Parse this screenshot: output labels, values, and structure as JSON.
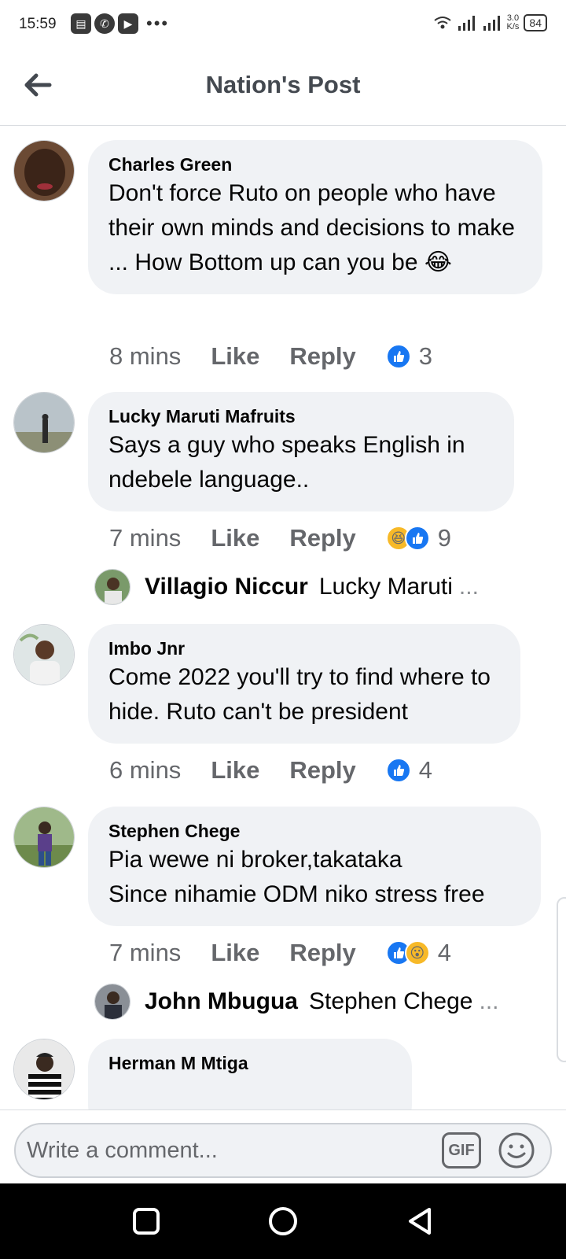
{
  "status": {
    "time": "15:59",
    "speed_top": "3.0",
    "speed_bottom": "K/s",
    "battery": "84"
  },
  "header": {
    "title": "Nation's Post"
  },
  "comments": [
    {
      "name": "Charles Green",
      "text": "Don't force Ruto on people who have their own minds and decisions to make ... How Bottom up can you be 😂",
      "time": "8 mins",
      "like": "Like",
      "reply": "Reply",
      "count": "3",
      "reactions": [
        "like"
      ]
    },
    {
      "name": "Lucky Maruti Mafruits",
      "text": "Says a guy who speaks English in ndebele language..",
      "time": "7 mins",
      "like": "Like",
      "reply": "Reply",
      "count": "9",
      "reactions": [
        "haha",
        "like"
      ],
      "reply_preview": {
        "name": "Villagio Niccur",
        "text": "Lucky Maruti",
        "ellipsis": "..."
      }
    },
    {
      "name": "Imbo Jnr",
      "text": "Come 2022 you'll try to find where to hide. Ruto can't be president",
      "time": "6 mins",
      "like": "Like",
      "reply": "Reply",
      "count": "4",
      "reactions": [
        "like"
      ]
    },
    {
      "name": "Stephen Chege",
      "text_line1": "Pia wewe ni broker,takataka",
      "text_line2": "Since nihamie ODM niko stress free",
      "time": "7 mins",
      "like": "Like",
      "reply": "Reply",
      "count": "4",
      "reactions": [
        "like",
        "wow"
      ],
      "reply_preview": {
        "name": "John Mbugua",
        "text": "Stephen Chege",
        "ellipsis": "..."
      }
    },
    {
      "name": "Herman M Mtiga"
    }
  ],
  "composer": {
    "placeholder": "Write a comment...",
    "gif_label": "GIF"
  },
  "colors": {
    "like_blue": "#1877f2",
    "bubble": "#f0f2f5",
    "meta_gray": "#65676b"
  }
}
